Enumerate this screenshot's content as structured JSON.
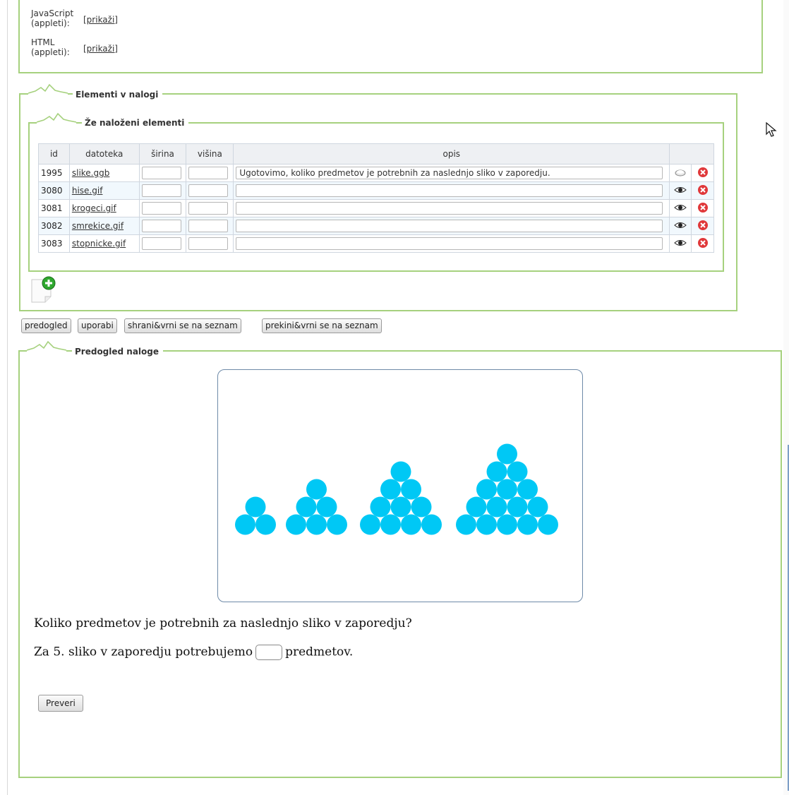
{
  "applets": {
    "js_label_1": "JavaScript",
    "js_label_2": "(appleti):",
    "js_link": "[prikaži]",
    "html_label_1": "HTML",
    "html_label_2": "(appleti):",
    "html_link": "[prikaži]"
  },
  "sections": {
    "elements_title": "Elementi v nalogi",
    "loaded_title": "Že naloženi elementi",
    "preview_title": "Predogled naloge"
  },
  "table": {
    "headers": [
      "id",
      "datoteka",
      "širina",
      "višina",
      "opis",
      ""
    ],
    "rows": [
      {
        "id": "1995",
        "file": "slike.ggb",
        "width": "",
        "height": "",
        "desc": "Ugotovimo, koliko predmetov je potrebnih za naslednjo sliko v zaporedju."
      },
      {
        "id": "3080",
        "file": "hise.gif",
        "width": "",
        "height": "",
        "desc": ""
      },
      {
        "id": "3081",
        "file": "krogeci.gif",
        "width": "",
        "height": "",
        "desc": ""
      },
      {
        "id": "3082",
        "file": "smrekice.gif",
        "width": "",
        "height": "",
        "desc": ""
      },
      {
        "id": "3083",
        "file": "stopnicke.gif",
        "width": "",
        "height": "",
        "desc": ""
      }
    ]
  },
  "buttons": {
    "preview": "predogled",
    "apply": "uporabi",
    "save_return": "shrani&vrni se na seznam",
    "cancel_return": "prekini&vrni se na seznam"
  },
  "task": {
    "question": "Koliko predmetov je potrebnih za naslednjo sliko v zaporedju?",
    "answer_prefix": "Za 5. sliko v zaporedju potrebujemo",
    "answer_suffix": "predmetov.",
    "check_button": "Preveri"
  },
  "colors": {
    "frame_green": "#a6d17e",
    "circle_blue": "#00c8f5",
    "delete_red": "#e0383a"
  },
  "figure": {
    "triangle_rows": [
      2,
      3,
      4,
      5
    ]
  }
}
